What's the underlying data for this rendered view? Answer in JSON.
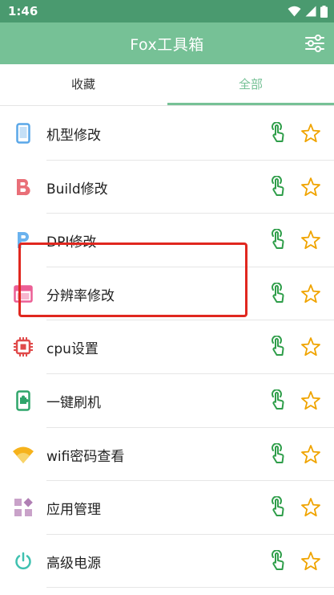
{
  "status_bar": {
    "time": "1:46"
  },
  "app_bar": {
    "title": "Fox工具箱"
  },
  "tabs": [
    {
      "label": "收藏",
      "selected": false
    },
    {
      "label": "全部",
      "selected": true
    }
  ],
  "colors": {
    "status_bar": "#4a9a6f",
    "app_bar": "#76c196",
    "accent": "#76c196",
    "touch_icon": "#2f9e4a",
    "star_outline": "#f0a400",
    "highlight": "#e0271f"
  },
  "items": [
    {
      "label": "机型修改",
      "icon": "phone-icon"
    },
    {
      "label": "Build修改",
      "icon": "letter-b-icon"
    },
    {
      "label": "DPI修改",
      "icon": "letter-p-icon"
    },
    {
      "label": "分辨率修改",
      "icon": "window-icon"
    },
    {
      "label": "cpu设置",
      "icon": "cpu-chip-icon"
    },
    {
      "label": "一键刷机",
      "icon": "phone-puzzle-icon"
    },
    {
      "label": "wifi密码查看",
      "icon": "wifi-icon"
    },
    {
      "label": "应用管理",
      "icon": "app-grid-icon"
    },
    {
      "label": "高级电源",
      "icon": "power-icon"
    }
  ]
}
